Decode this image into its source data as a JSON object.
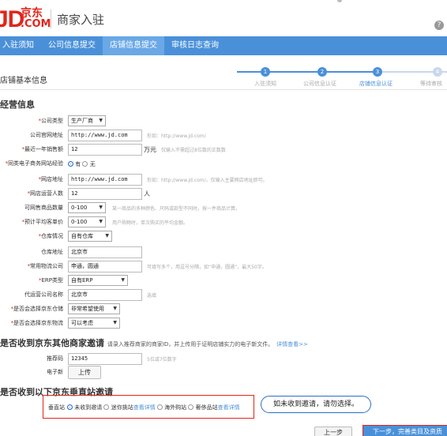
{
  "header": {
    "logo_jd": "JD",
    "logo_cn": "京东",
    "logo_com": ".COM",
    "title": "商家入驻",
    "help_icon": "question-circle-icon",
    "help_text": "?"
  },
  "nav": {
    "tabs": [
      {
        "label": "入驻须知"
      },
      {
        "label": "公司信息提交"
      },
      {
        "label": "店铺信息提交"
      },
      {
        "label": "审核日志查询"
      }
    ],
    "active_index": 2,
    "color": "#4a90d9"
  },
  "stepbar": {
    "title": "店铺基本信息",
    "steps": [
      {
        "num": "1",
        "label": "入驻须知"
      },
      {
        "num": "2",
        "label": "公司信息认证"
      },
      {
        "num": "3",
        "label": "店铺信息认证"
      },
      {
        "num": "4",
        "label": "等待审核"
      }
    ],
    "current": 3
  },
  "business": {
    "title": "经营信息",
    "company_type": {
      "label": "*公司类型",
      "value": "生产厂商"
    },
    "website": {
      "label": "公司官网地址",
      "value": "http://www.jd.com",
      "hint": "形如：http://www.jd.com/"
    },
    "sales": {
      "label": "*最近一年销售额",
      "value": "12",
      "unit": "万元",
      "hint": "仅输入不需超过8位数的正数数"
    },
    "experience": {
      "label": "*同类电子商务网站经验",
      "opt_yes": "有",
      "opt_no": "无"
    },
    "shop_url": {
      "label": "*网店地址",
      "value": "http://www.jd.com",
      "hint": "形如：http://www.jd.com/，仅输入主要网店地址即可。"
    },
    "ops_count": {
      "label": "*网店运营人数",
      "value": "12",
      "unit": "人"
    },
    "sku_count": {
      "label": "可网售商品数量",
      "value": "0-100",
      "hint": "某一商品的多种颜色、尺码或款型不同时，按一件商品计算。"
    },
    "avg_price": {
      "label": "*预计平均客单价",
      "value": "0-100",
      "hint": "用户购物时，单次购买的平均金额。"
    },
    "warehouse": {
      "label": "*仓库情况",
      "value": "自有仓库"
    },
    "warehouse_addr": {
      "label": "仓库地址",
      "value": "北京市"
    },
    "logistics": {
      "label": "*常用物流公司",
      "value": "申通，圆通",
      "hint": "可填写多个，用逗号分隔，如“申通，圆通”，最大50字。"
    },
    "erp": {
      "label": "*ERP类型",
      "value": "自有ERP"
    },
    "agency": {
      "label": "代运营公司名称",
      "value": "北京市",
      "hint": "选填"
    },
    "jd_warehouse": {
      "label": "*是否会选择京东仓储",
      "value": "非常希望使用"
    },
    "jd_logistics": {
      "label": "*是否会选择京东物流",
      "value": "可以考虑"
    }
  },
  "invite": {
    "title": "是否收到京东其他商家邀请",
    "desc": "请录入推荐商家的商家ID，并上传用于证明店铺实力的电子新文件。",
    "link": "详情查看>>",
    "code": {
      "label": "推荐码",
      "value": "12345",
      "hint": "5位或7位数字"
    },
    "file": {
      "label": "电子新",
      "button": "上传"
    }
  },
  "vertical": {
    "title": "是否收到以下京东垂直站邀请",
    "label": "垂直站",
    "options": [
      {
        "text": "未收到邀请",
        "link": ""
      },
      {
        "text": "迷你挑站",
        "link": "查看详情"
      },
      {
        "text": "海外购站",
        "link": ""
      },
      {
        "text": "奢侈品站",
        "link": "查看详情"
      }
    ],
    "callout": "如未收到邀请，请勿选择。"
  },
  "footer": {
    "prev": "上一步",
    "next": "下一步，完善类目及资质"
  }
}
